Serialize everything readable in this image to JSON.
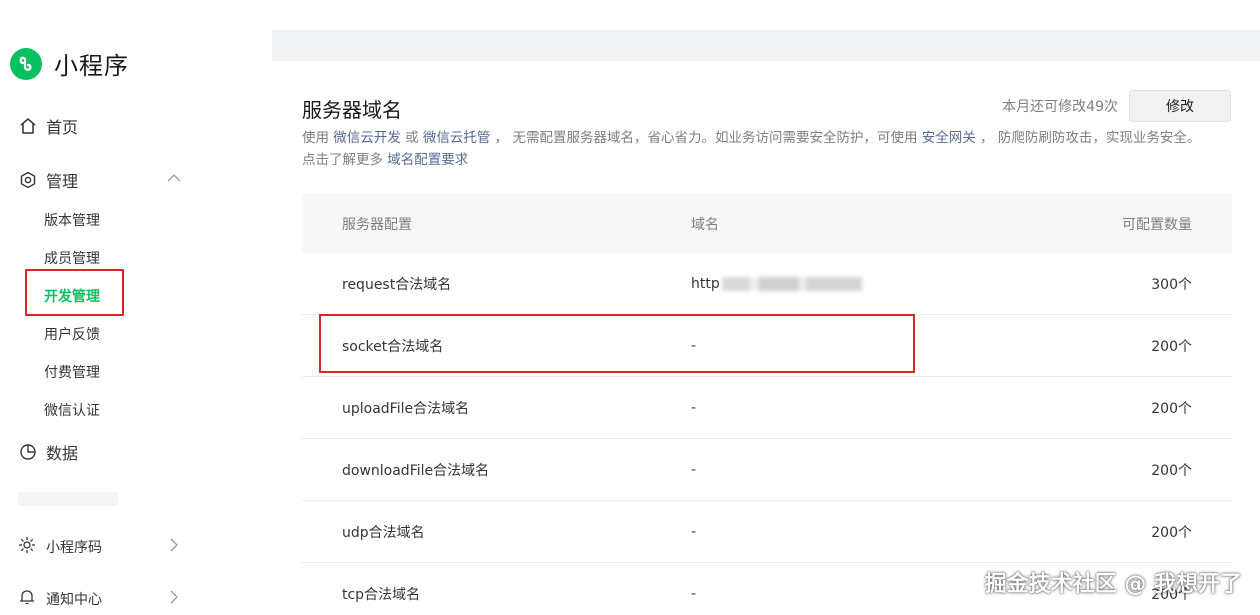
{
  "brand": {
    "name": "小程序",
    "logo_icon": "miniprogram-logo-icon",
    "color": "#07c160"
  },
  "sidebar": {
    "home": {
      "label": "首页",
      "icon": "home-icon"
    },
    "manage": {
      "label": "管理",
      "icon": "gear-icon",
      "expanded": true,
      "children": [
        {
          "label": "版本管理"
        },
        {
          "label": "成员管理"
        },
        {
          "label": "开发管理",
          "active": true
        },
        {
          "label": "用户反馈"
        },
        {
          "label": "付费管理"
        },
        {
          "label": "微信认证"
        }
      ]
    },
    "data": {
      "label": "数据",
      "icon": "pie-chart-icon"
    },
    "bottom": [
      {
        "label": "小程序码",
        "icon": "sun-code-icon"
      },
      {
        "label": "通知中心",
        "icon": "bell-icon"
      }
    ]
  },
  "section": {
    "title": "服务器域名",
    "remaining": "本月还可修改49次",
    "edit_label": "修改",
    "desc": {
      "t1": "使用 ",
      "link1": "微信云开发",
      "t2": " 或 ",
      "link2": "微信云托管",
      "t3": " ， 无需配置服务器域名，省心省力。如业务访问需要安全防护，可使用 ",
      "link3": "安全网关",
      "t4": " ， 防爬防刷防攻击，实现业务安全。",
      "t5": "点击了解更多 ",
      "link4": "域名配置要求"
    }
  },
  "table": {
    "headers": [
      "服务器配置",
      "域名",
      "可配置数量"
    ],
    "rows": [
      {
        "name": "request合法域名",
        "domain": "http",
        "count": "300个",
        "domain_blurred": true
      },
      {
        "name": "socket合法域名",
        "domain": "-",
        "count": "200个"
      },
      {
        "name": "uploadFile合法域名",
        "domain": "-",
        "count": "200个"
      },
      {
        "name": "downloadFile合法域名",
        "domain": "-",
        "count": "200个"
      },
      {
        "name": "udp合法域名",
        "domain": "-",
        "count": "200个"
      },
      {
        "name": "tcp合法域名",
        "domain": "-",
        "count": "200个"
      }
    ]
  },
  "watermark": "掘金技术社区 @ 我想开了",
  "colors": {
    "accent": "#07c160",
    "link": "#576b95",
    "highlight": "#d9252a"
  }
}
